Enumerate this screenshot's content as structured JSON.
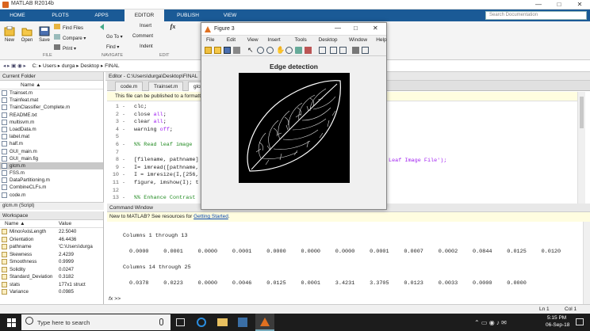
{
  "window": {
    "title": "MATLAB R2014b",
    "min": "—",
    "max": "□",
    "close": "✕"
  },
  "tabs": [
    "HOME",
    "PLOTS",
    "APPS",
    "EDITOR",
    "PUBLISH",
    "VIEW"
  ],
  "search": {
    "placeholder": "Search Documentation"
  },
  "ribbon": {
    "new": "New",
    "open": "Open",
    "save": "Save",
    "find_files": "Find Files",
    "compare": "Compare ▾",
    "print": "Print ▾",
    "insert": "Insert",
    "fx": "fx",
    "comment": "Comment",
    "go_to": "Go To ▾",
    "find": "Find ▾",
    "indent": "Indent",
    "group_file": "FILE",
    "group_navigate": "NAVIGATE",
    "group_edit": "EDIT"
  },
  "address": {
    "parts": [
      "C:",
      "Users",
      "durga",
      "Desktop",
      "FINAL"
    ]
  },
  "current_folder": {
    "title": "Current Folder",
    "col_name": "Name ▲",
    "files": [
      "Trainset.m",
      "Trainfeat.mat",
      "TrainClassifier_Complete.m",
      "README.txt",
      "multisvm.m",
      "LoadData.m",
      "label.mat",
      "half.m",
      "GUI_main.m",
      "GUI_main.fig",
      "glcm.m",
      "FSS.m",
      "DataPartitioning.m",
      "CombineCLFs.m",
      "code.m"
    ],
    "selected": "glcm.m",
    "detail": "glcm.m (Script)"
  },
  "workspace": {
    "title": "Workspace",
    "col_name": "Name ▲",
    "col_value": "Value",
    "rows": [
      {
        "name": "MinorAxisLength",
        "value": "22.5040"
      },
      {
        "name": "Orientation",
        "value": "46.4436"
      },
      {
        "name": "pathname",
        "value": "'C:\\Users\\durga"
      },
      {
        "name": "Skewness",
        "value": "2.4239"
      },
      {
        "name": "Smoothness",
        "value": "0.9999"
      },
      {
        "name": "Solidity",
        "value": "0.0247"
      },
      {
        "name": "Standard_Deviation",
        "value": "0.3182"
      },
      {
        "name": "stats",
        "value": "177x1 struct"
      },
      {
        "name": "Variance",
        "value": "0.0985"
      }
    ]
  },
  "editor": {
    "header": "Editor - C:\\Users\\durga\\Desktop\\FINAL",
    "tabs": [
      "code.m",
      "Trainset.m",
      "glcm"
    ],
    "info": "This file can be published to a formatt",
    "lines": [
      {
        "n": "1",
        "c": "clc;"
      },
      {
        "n": "2",
        "c": "close all;"
      },
      {
        "n": "3",
        "c": "clear all;"
      },
      {
        "n": "4",
        "c": "warning off;"
      },
      {
        "n": "5",
        "c": ""
      },
      {
        "n": "6",
        "c": "%% Read leaf image"
      },
      {
        "n": "7",
        "c": ""
      },
      {
        "n": "8",
        "c": "[filename, pathname]"
      },
      {
        "n": "9",
        "c": "I= imread([pathname,"
      },
      {
        "n": "10",
        "c": "I = imresize(I,[256,"
      },
      {
        "n": "11",
        "c": "figure, imshow(I); t"
      },
      {
        "n": "12",
        "c": ""
      },
      {
        "n": "13",
        "c": "%% Enhance Contrast"
      }
    ],
    "overflow": "Leaf Image File');"
  },
  "command_window": {
    "title": "Command Window",
    "new_msg": "New to MATLAB? See resources for ",
    "new_link": "Getting Started",
    "new_end": ".",
    "h1": "Columns 1 through 13",
    "r1": [
      "0.0000",
      "0.0001",
      "0.0000",
      "0.0001",
      "0.0000",
      "0.0000",
      "0.0000",
      "0.0001",
      "0.0007",
      "0.0002",
      "0.0844",
      "0.0125",
      "0.0120"
    ],
    "h2": "Columns 14 through 25",
    "r2": [
      "0.0378",
      "0.0223",
      "0.0000",
      "0.0046",
      "0.0125",
      "0.0001",
      "3.4231",
      "3.3705",
      "0.0123",
      "0.0033",
      "0.0000",
      "0.0000"
    ],
    "prompt": "fx >>"
  },
  "status": {
    "ln": "Ln 1",
    "col": "Col 1"
  },
  "figure": {
    "title": "Figure 3",
    "menu": [
      "File",
      "Edit",
      "View",
      "Insert",
      "Tools",
      "Desktop",
      "Window",
      "Help"
    ],
    "plot_title": "Edge detection"
  },
  "taskbar": {
    "search": "Type here to search",
    "time": "5:15 PM",
    "date": "06-Sep-18"
  }
}
